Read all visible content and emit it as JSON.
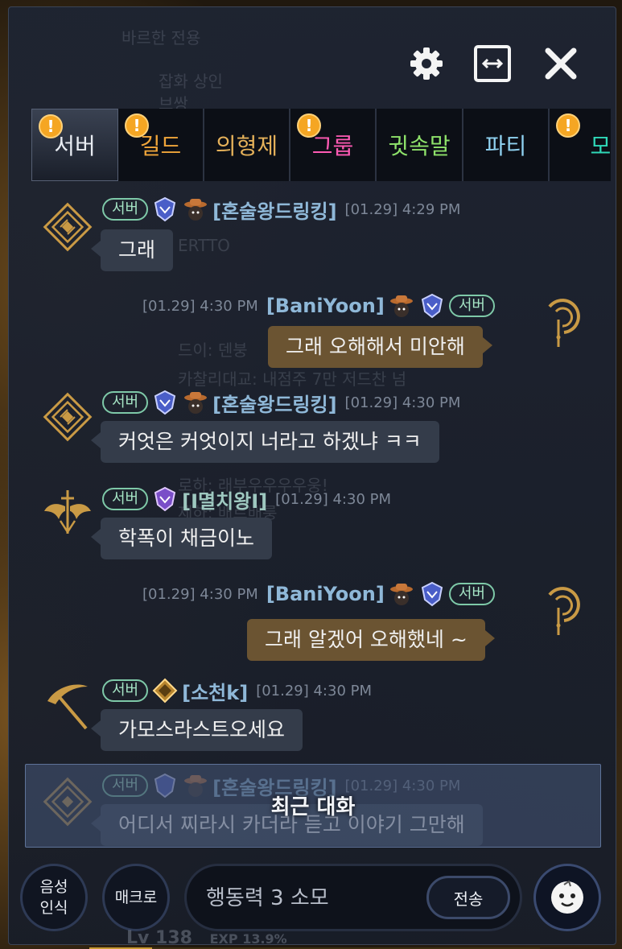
{
  "background_ui": {
    "ghost_lines": [
      "바르한 전용",
      "잡화 상인",
      "브쌍",
      "드이: 덴붕",
      "카찰리대교: 내점주 7만 저드찬 넘",
      "로하: 래부우우우우웅!",
      "제하: 배르배룽",
      "ERTTO"
    ]
  },
  "toolbar": {
    "settings_icon": "gear-icon",
    "expand_icon": "expand-icon",
    "close_icon": "close-icon"
  },
  "tabs": [
    {
      "label": "서버",
      "color": "#e8ecf2",
      "badge": "!",
      "active": true
    },
    {
      "label": "길드",
      "color": "#f0a53a",
      "badge": "!",
      "active": false
    },
    {
      "label": "의형제",
      "color": "#e5b15a",
      "badge": "",
      "active": false
    },
    {
      "label": "그룹",
      "color": "#ff5ab4",
      "badge": "!",
      "active": false
    },
    {
      "label": "귓속말",
      "color": "#8ee26a",
      "badge": "",
      "active": false
    },
    {
      "label": "파티",
      "color": "#8fd1f0",
      "badge": "",
      "active": false
    },
    {
      "label": "모집",
      "color": "#2fd8b8",
      "badge": "!",
      "active": false
    }
  ],
  "messages": [
    {
      "side": "other",
      "channel": "서버",
      "name": "[혼술왕드링킹]",
      "name_color": "#8fb8d8",
      "time": "[01.29] 4:29 PM",
      "text": "그래"
    },
    {
      "side": "self",
      "channel": "서버",
      "name": "[BaniYoon]",
      "name_color": "#8fb8d8",
      "time": "[01.29] 4:30 PM",
      "text": "그래 오해해서 미안해"
    },
    {
      "side": "other",
      "channel": "서버",
      "name": "[혼술왕드링킹]",
      "name_color": "#8fb8d8",
      "time": "[01.29] 4:30 PM",
      "text": "커엇은 커엇이지 너라고 하겠냐 ㅋㅋ"
    },
    {
      "side": "other",
      "channel": "서버",
      "name": "[I멸치왕I]",
      "name_color": "#9ec8c0",
      "time": "[01.29] 4:30 PM",
      "text": "학폭이 채금이노"
    },
    {
      "side": "self",
      "channel": "서버",
      "name": "[BaniYoon]",
      "name_color": "#8fb8d8",
      "time": "[01.29] 4:30 PM",
      "text": "그래 알겠어 오해했네 ~"
    },
    {
      "side": "other",
      "channel": "서버",
      "name": "[소천k]",
      "name_color": "#8fb8d8",
      "time": "[01.29] 4:30 PM",
      "text": "가모스라스트오세요"
    },
    {
      "side": "other",
      "channel": "서버",
      "name": "[혼술왕드링킹]",
      "name_color": "#8fb8d8",
      "time": "[01.29] 4:30 PM",
      "text": "어디서 찌라시 카더라 듣고 이야기 그만해"
    }
  ],
  "recent_overlay": {
    "label": "최근 대화"
  },
  "bottom": {
    "voice_label": "음성\n인식",
    "macro_label": "매크로",
    "input_placeholder": "행동력 3 소모",
    "send_label": "전송",
    "emoji_icon": "emoji-face-icon"
  },
  "status": {
    "level": "Lv 138",
    "exp": "EXP 13.9%",
    "exp_progress": 0.139
  }
}
